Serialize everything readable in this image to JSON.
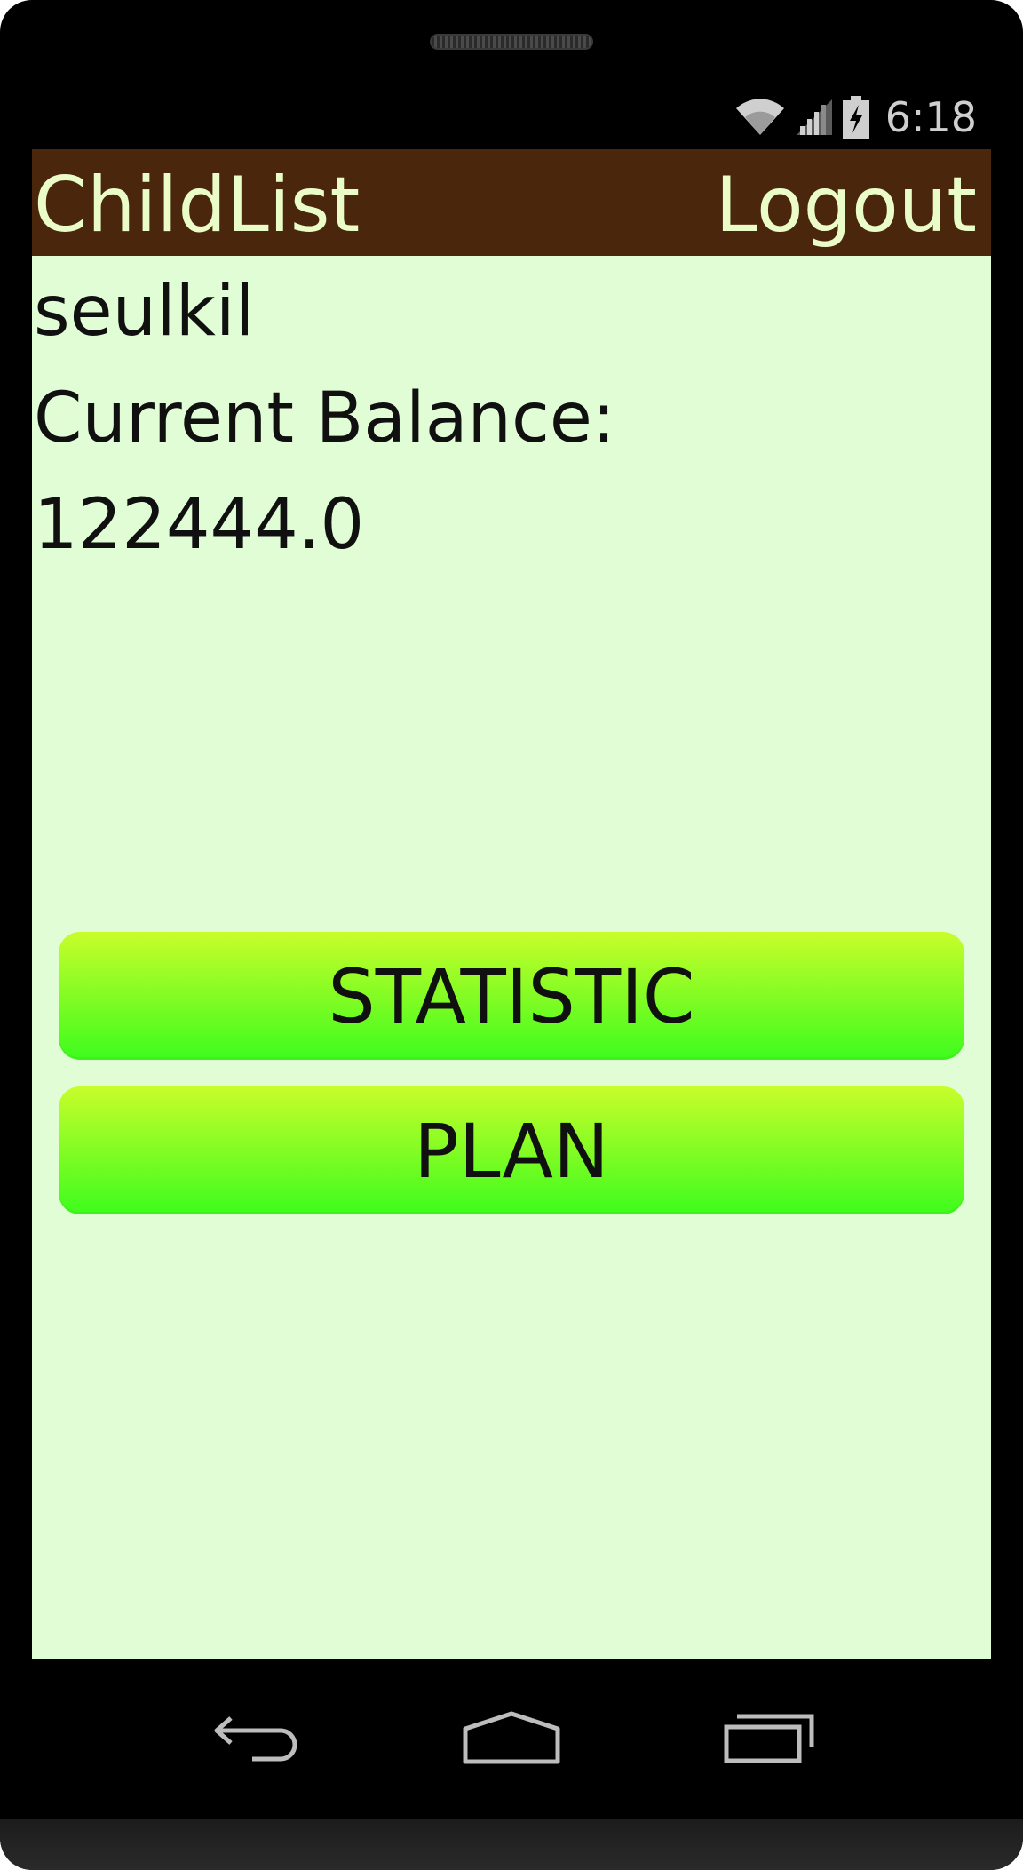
{
  "device": {
    "speaker_icon": "speaker-grille",
    "status_bar": {
      "time": "6:18",
      "icons": [
        "wifi-icon",
        "signal-icon",
        "battery-charging-icon"
      ],
      "icon_color": "#cfcfcf"
    },
    "nav_bar": {
      "back_icon": "back-arrow-icon",
      "home_icon": "home-icon",
      "recents_icon": "recent-apps-icon",
      "icon_color": "#bdbdbd"
    }
  },
  "app_bar": {
    "title": "ChildList",
    "logout_label": "Logout",
    "background": "#4a260c",
    "text_color": "#eafcc8"
  },
  "content": {
    "background": "#e1fdd5",
    "child_name": "seulkil",
    "balance_label": "Current Balance:",
    "balance_value": "122444.0"
  },
  "buttons": {
    "statistic_label": "STATISTIC",
    "plan_label": "PLAN",
    "gradient_top": "#c8fd2a",
    "gradient_bottom": "#3efc1e"
  }
}
